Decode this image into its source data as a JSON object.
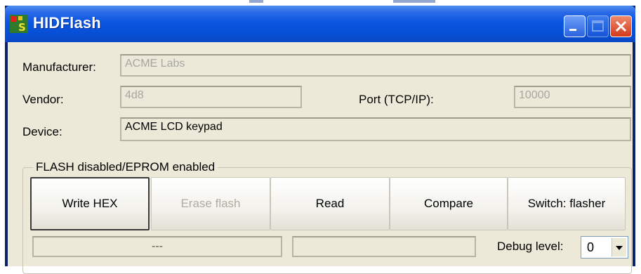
{
  "window": {
    "title": "HIDFlash",
    "icon": "hidflash-app-icon"
  },
  "titlebar_buttons": {
    "minimize": "minimize-icon",
    "maximize": "maximize-icon",
    "close": "close-icon"
  },
  "fields": {
    "manufacturer": {
      "label": "Manufacturer:",
      "value": "ACME Labs"
    },
    "vendor": {
      "label": "Vendor:",
      "value": "4d8"
    },
    "port": {
      "label": "Port (TCP/IP):",
      "value": "10000"
    },
    "device": {
      "label": "Device:",
      "value": "ACME LCD keypad"
    }
  },
  "group": {
    "title": "FLASH disabled/EPROM enabled"
  },
  "buttons": {
    "write_hex": "Write HEX",
    "erase_flash": "Erase flash",
    "read": "Read",
    "compare": "Compare",
    "switch": "Switch: flasher"
  },
  "status": {
    "left": "---",
    "right": ""
  },
  "debug": {
    "label": "Debug level:",
    "value": "0"
  },
  "colors": {
    "titlebar": "#0a55e1",
    "face": "#ece9d8",
    "disabled_text": "#a7a6a0"
  }
}
